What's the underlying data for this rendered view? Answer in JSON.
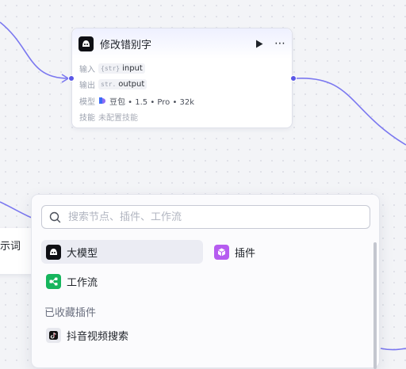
{
  "node": {
    "title": "修改错别字",
    "icon": "model-icon",
    "inputs_label": "输入",
    "input": {
      "type": "{str}",
      "name": "input"
    },
    "outputs_label": "输出",
    "output": {
      "type": "str.",
      "name": "output"
    },
    "model_label": "模型",
    "model_value": "豆包 • 1.5 • Pro • 32k",
    "skills_label": "技能",
    "skills_value": "未配置技能"
  },
  "partial_node": {
    "text": "示词"
  },
  "panel": {
    "search_placeholder": "搜索节点、插件、工作流",
    "items": [
      {
        "label": "大模型",
        "icon": "model-icon",
        "active": true
      },
      {
        "label": "插件",
        "icon": "plugin-icon",
        "active": false
      },
      {
        "label": "工作流",
        "icon": "workflow-icon",
        "active": false
      }
    ],
    "section_title": "已收藏插件",
    "favorites": [
      {
        "label": "抖音视频搜索",
        "icon": "douyin-icon"
      }
    ]
  },
  "colors": {
    "accent": "#5a57e6",
    "edge": "#7b78f0",
    "plugin": "#b65cf0",
    "workflow": "#16b55d"
  }
}
